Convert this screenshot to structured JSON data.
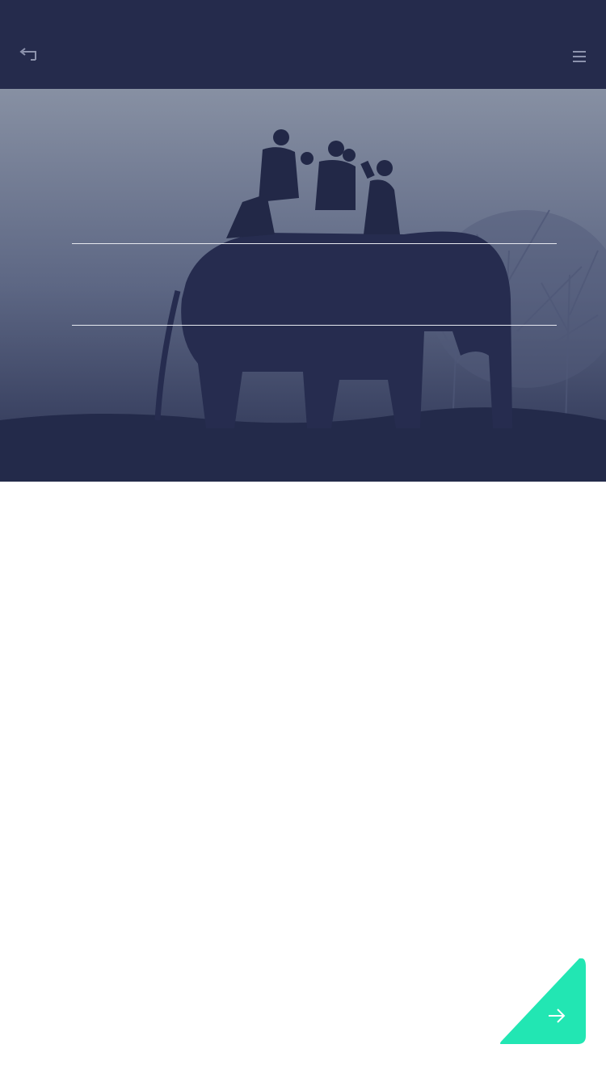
{
  "header": {
    "back_icon": "back-return-icon",
    "menu_icon": "hamburger-menu-icon",
    "background_color": "#252b4c"
  },
  "hero": {
    "image_subject": "elephant-with-riders-silhouette-in-fog",
    "overlay_color": "#252b4c"
  },
  "footer": {
    "next_icon": "arrow-right-icon",
    "accent_color": "#22e6b3"
  }
}
